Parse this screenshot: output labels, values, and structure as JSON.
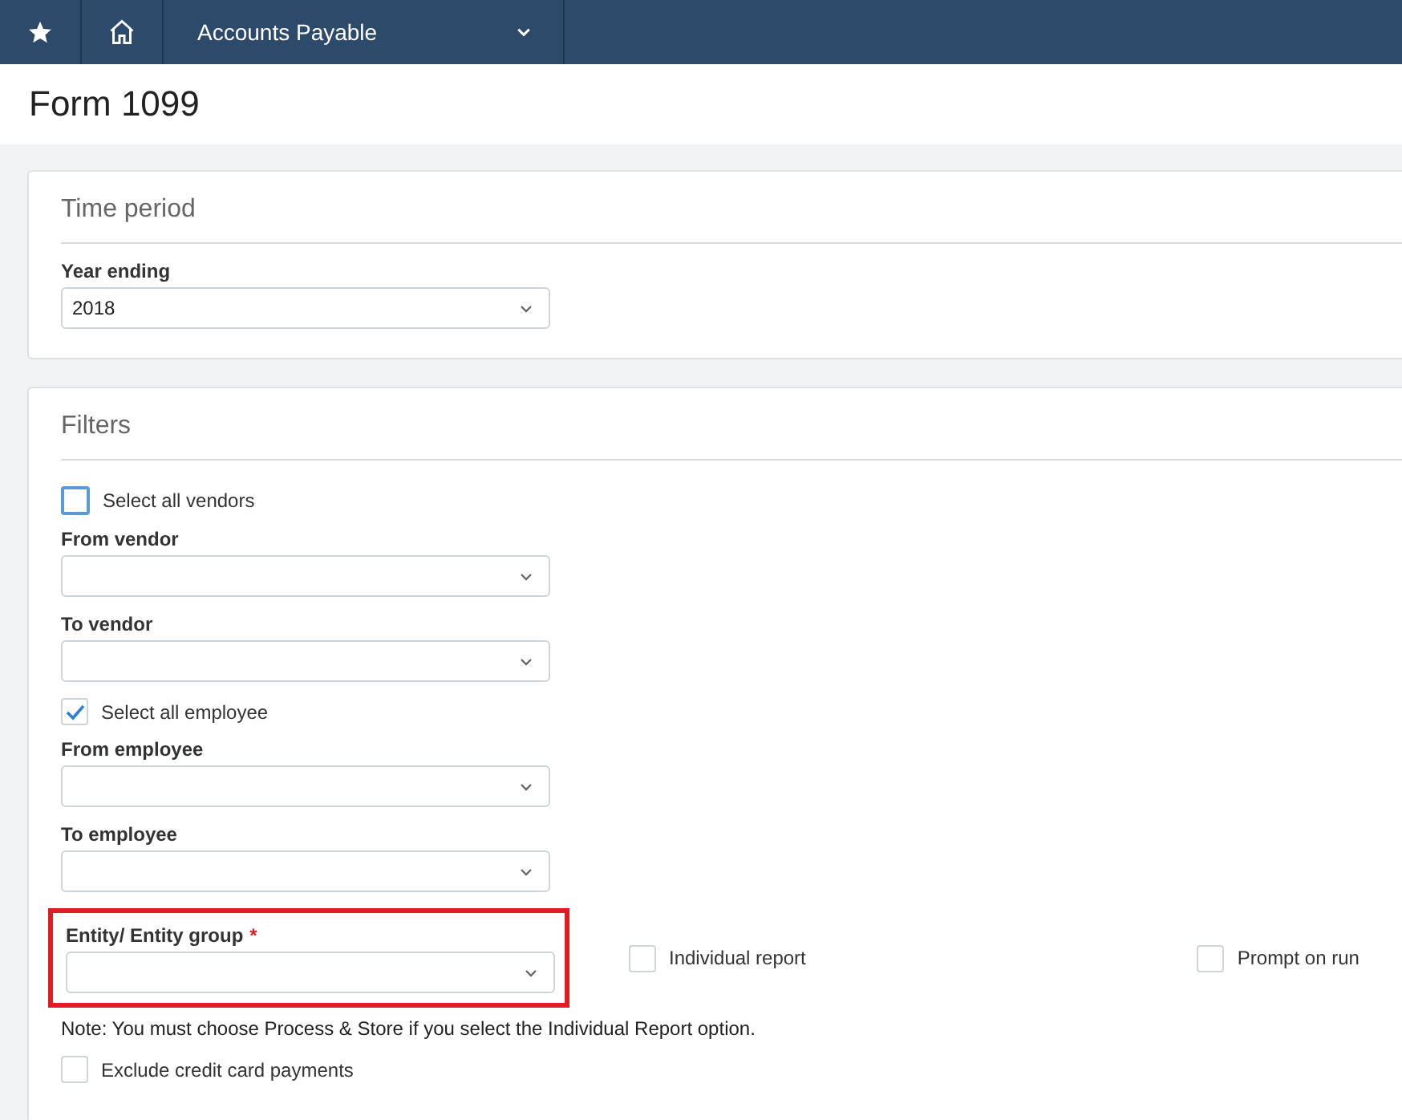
{
  "nav": {
    "module": "Accounts Payable"
  },
  "page_title": "Form 1099",
  "time_period": {
    "title": "Time period",
    "year_label": "Year ending",
    "year_value": "2018"
  },
  "filters": {
    "title": "Filters",
    "items": [
      {
        "kind": "checkbox",
        "label": "Select all vendors",
        "checked": false,
        "focused": true
      },
      {
        "kind": "select",
        "label": "From vendor"
      },
      {
        "kind": "select",
        "label": "To vendor"
      },
      {
        "kind": "checkbox",
        "label": "Select all employee",
        "checked": true,
        "focused": false
      },
      {
        "kind": "select",
        "label": "From employee"
      },
      {
        "kind": "select",
        "label": "To employee"
      }
    ],
    "entity": {
      "label": "Entity/ Entity group",
      "required_mark": "*",
      "highlighted": true
    },
    "entity_options": [
      {
        "label": "Individual report",
        "checked": false
      },
      {
        "label": "Prompt on run",
        "checked": false
      }
    ],
    "note": "Note: You must choose Process & Store if you select the Individual Report option.",
    "exclude": {
      "label": "Exclude credit card payments",
      "checked": false
    }
  }
}
